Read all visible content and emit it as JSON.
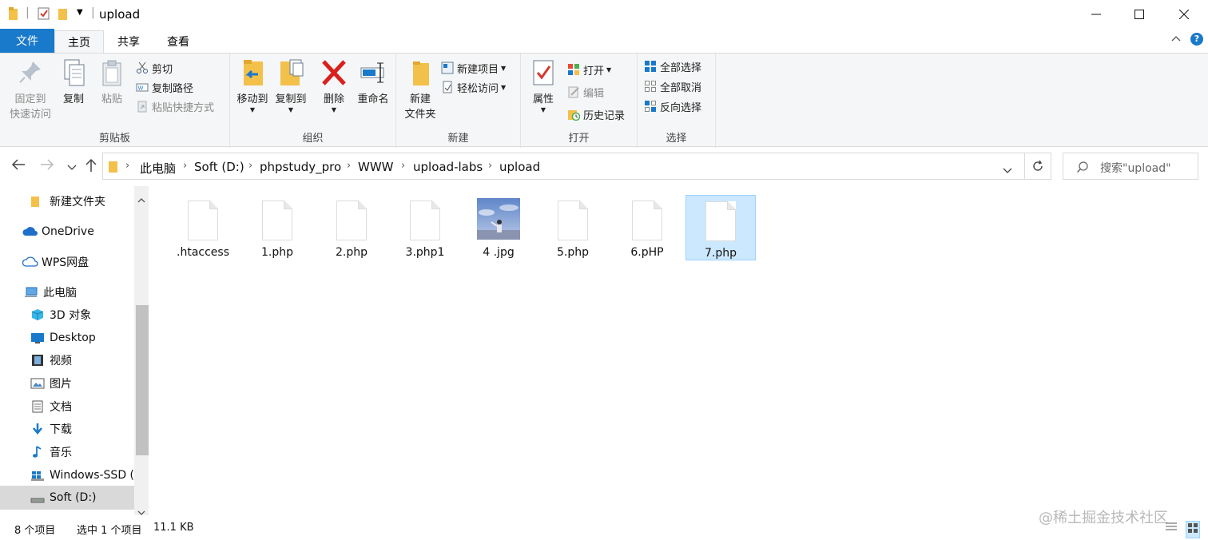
{
  "window": {
    "title": "upload"
  },
  "tabs": [
    {
      "label": "文件"
    },
    {
      "label": "主页"
    },
    {
      "label": "共享"
    },
    {
      "label": "查看"
    }
  ],
  "ribbon": {
    "clipboard": {
      "group_label": "剪贴板",
      "pin": "固定到\n快速访问",
      "pin_line1": "固定到",
      "pin_line2": "快速访问",
      "copy": "复制",
      "paste": "粘贴",
      "cut": "剪切",
      "copy_path": "复制路径",
      "paste_shortcut": "粘贴快捷方式"
    },
    "organize": {
      "group_label": "组织",
      "move_to": "移动到",
      "copy_to": "复制到",
      "delete": "删除",
      "rename": "重命名"
    },
    "new": {
      "group_label": "新建",
      "new_folder_line1": "新建",
      "new_folder_line2": "文件夹",
      "new_item": "新建项目",
      "easy_access": "轻松访问"
    },
    "open": {
      "group_label": "打开",
      "properties": "属性",
      "open": "打开",
      "edit": "编辑",
      "history": "历史记录"
    },
    "select": {
      "group_label": "选择",
      "select_all": "全部选择",
      "select_none": "全部取消",
      "invert": "反向选择"
    }
  },
  "address": {
    "crumbs": [
      "此电脑",
      "Soft (D:)",
      "phpstudy_pro",
      "WWW",
      "upload-labs",
      "upload"
    ],
    "search_placeholder": "搜索\"upload\""
  },
  "nav": {
    "items": [
      {
        "label": "新建文件夹"
      },
      {
        "label": "OneDrive"
      },
      {
        "label": "WPS网盘"
      },
      {
        "label": "此电脑"
      },
      {
        "label": "3D 对象"
      },
      {
        "label": "Desktop"
      },
      {
        "label": "视频"
      },
      {
        "label": "图片"
      },
      {
        "label": "文档"
      },
      {
        "label": "下载"
      },
      {
        "label": "音乐"
      },
      {
        "label": "Windows-SSD ("
      },
      {
        "label": "Soft (D:)"
      }
    ]
  },
  "files": [
    {
      "name": ".htaccess"
    },
    {
      "name": "1.php"
    },
    {
      "name": "2.php"
    },
    {
      "name": "3.php1"
    },
    {
      "name": "4 .jpg"
    },
    {
      "name": "5.php"
    },
    {
      "name": "6.pHP"
    },
    {
      "name": "7.php"
    }
  ],
  "status": {
    "count": "8 个项目",
    "selection": "选中 1 个项目",
    "size": "11.1 KB"
  },
  "watermark": {
    "text": "@稀土掘金技术社区"
  },
  "colors": {
    "accent": "#1979ca",
    "selection": "#cce8ff"
  }
}
